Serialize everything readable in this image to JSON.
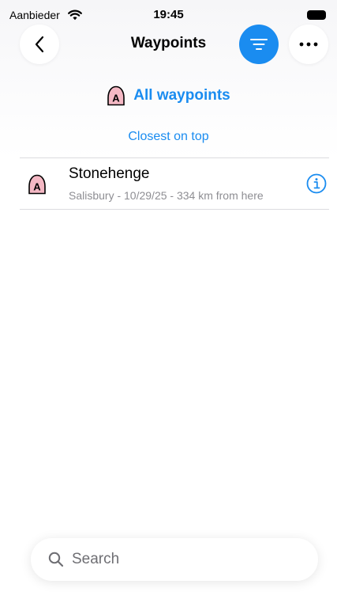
{
  "status_bar": {
    "carrier": "Aanbieder",
    "time": "19:45",
    "wifi_icon": "wifi-icon",
    "battery_icon": "battery-icon"
  },
  "nav": {
    "title": "Waypoints",
    "back_icon": "chevron-left-icon",
    "filter_icon": "filter-lines-icon",
    "more_icon": "ellipsis-icon"
  },
  "selector": {
    "label": "All waypoints",
    "icon": "waypoint-marker-icon",
    "icon_letter": "A"
  },
  "sort": {
    "label": "Closest on top"
  },
  "waypoints": [
    {
      "name": "Stonehenge",
      "details": "Salisbury - 10/29/25 - 334 km from here",
      "icon_letter": "A",
      "icon": "waypoint-marker-icon",
      "info_icon": "info-circle-icon"
    }
  ],
  "search": {
    "placeholder": "Search",
    "value": "",
    "icon": "search-icon"
  },
  "colors": {
    "accent": "#1a8cf0",
    "marker_fill": "#f4b8c4",
    "secondary_text": "#8e8e93",
    "divider": "#dcdcdf"
  }
}
